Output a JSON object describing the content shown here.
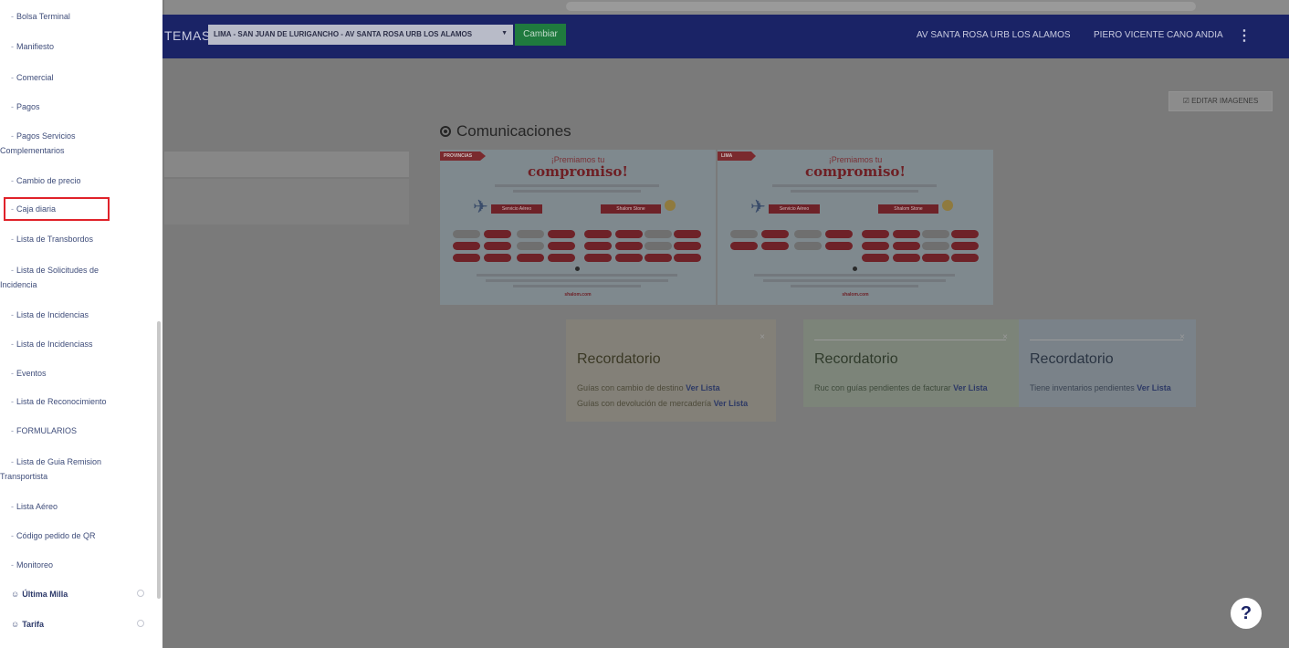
{
  "header": {
    "system_label_partial": "TEMAS",
    "agency_select_value": "LIMA - SAN JUAN DE LURIGANCHO - AV SANTA ROSA URB LOS ALAMOS",
    "cambiar_label": "Cambiar",
    "location": "AV SANTA ROSA URB LOS ALAMOS",
    "user": "PIERO VICENTE CANO ANDIA",
    "more_glyph": "⋮"
  },
  "sidebar": {
    "items": [
      {
        "label": "Bolsa Terminal"
      },
      {
        "label": "Manifiesto"
      },
      {
        "label": "Comercial"
      },
      {
        "label": "Pagos"
      },
      {
        "label": "Pagos Servicios",
        "label2": "Complementarios"
      },
      {
        "label": "Cambio de precio"
      },
      {
        "label": "Caja diaria",
        "highlighted": true
      },
      {
        "label": "Lista de Transbordos"
      },
      {
        "label": "Lista de Solicitudes de",
        "label2": "Incidencia"
      },
      {
        "label": "Lista de Incidencias"
      },
      {
        "label": "Lista de Incidenciass"
      },
      {
        "label": "Eventos"
      },
      {
        "label": "Lista de Reconocimiento"
      },
      {
        "label": "FORMULARIOS"
      },
      {
        "label": "Lista de Guia Remision",
        "label2": "Transportista"
      },
      {
        "label": "Lista Aéreo"
      },
      {
        "label": "Código pedido de QR"
      },
      {
        "label": "Monitoreo"
      }
    ],
    "parents": [
      {
        "label": "Última Milla"
      },
      {
        "label": "Tarifa"
      }
    ],
    "highlight_color": "#e0222a"
  },
  "main": {
    "edit_images_label": "EDITAR IMAGENES",
    "communications_title": "Comunicaciones",
    "banners": [
      {
        "tag": "PROVINCIAS",
        "line1": "¡Premiamos tu",
        "line2": "compromiso!",
        "ribbon_left": "Servicio Aéreo",
        "ribbon_right": "Shalom Stone",
        "brand": "shalom.com"
      },
      {
        "tag": "LIMA",
        "line1": "¡Premiamos tu",
        "line2": "compromiso!",
        "ribbon_left": "Servicio Aéreo",
        "ribbon_right": "Shalom Stone",
        "brand": "shalom.com"
      }
    ],
    "reminders": [
      {
        "title": "Recordatorio",
        "rows": [
          {
            "text": "Guías con cambio de destino",
            "link": "Ver Lista"
          },
          {
            "text": "Guías con devolución de mercadería",
            "link": "Ver Lista"
          }
        ]
      },
      {
        "title": "Recordatorio",
        "rows": [
          {
            "text": "Ruc con guías pendientes de facturar",
            "link": "Ver Lista"
          }
        ]
      },
      {
        "title": "Recordatorio",
        "rows": [
          {
            "text": "Tiene inventarios pendientes",
            "link": "Ver Lista"
          }
        ]
      }
    ],
    "close_glyph": "×",
    "help_glyph": "?"
  },
  "colors": {
    "header_bg": "#1a2366",
    "cambiar_bg": "#1f7a3e",
    "overlay": "#7a7a7a"
  }
}
